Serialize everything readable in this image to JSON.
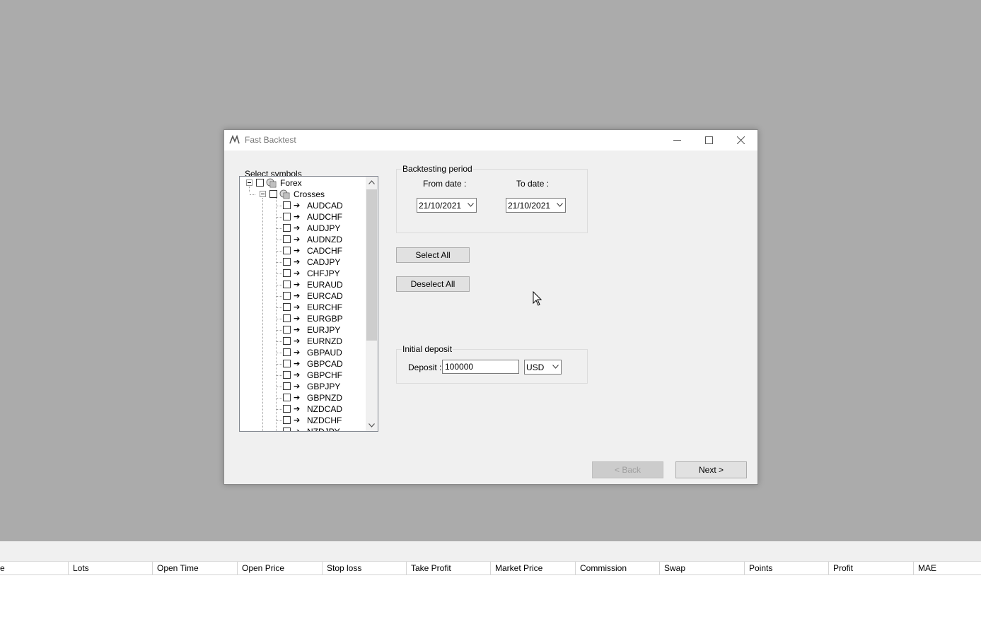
{
  "dialog": {
    "title": "Fast Backtest"
  },
  "symbols": {
    "group_label": "Select symbols",
    "root": "Forex",
    "folder": "Crosses",
    "items": [
      "AUDCAD",
      "AUDCHF",
      "AUDJPY",
      "AUDNZD",
      "CADCHF",
      "CADJPY",
      "CHFJPY",
      "EURAUD",
      "EURCAD",
      "EURCHF",
      "EURGBP",
      "EURJPY",
      "EURNZD",
      "GBPAUD",
      "GBPCAD",
      "GBPCHF",
      "GBPJPY",
      "GBPNZD",
      "NZDCAD",
      "NZDCHF",
      "NZDJPY"
    ],
    "arrow_glyph": "➔"
  },
  "period": {
    "group_label": "Backtesting period",
    "from_label": "From date :",
    "to_label": "To date :",
    "from_value": "21/10/2021",
    "to_value": "21/10/2021"
  },
  "buttons": {
    "select_all": "Select All",
    "deselect_all": "Deselect All",
    "back": "< Back",
    "next": "Next >"
  },
  "deposit": {
    "group_label": "Initial deposit",
    "label": "Deposit :",
    "value": "100000",
    "currency": "USD"
  },
  "grid": {
    "columns": [
      "e",
      "Lots",
      "Open Time",
      "Open Price",
      "Stop loss",
      "Take Profit",
      "Market Price",
      "Commission",
      "Swap",
      "Points",
      "Profit",
      "MAE"
    ]
  }
}
